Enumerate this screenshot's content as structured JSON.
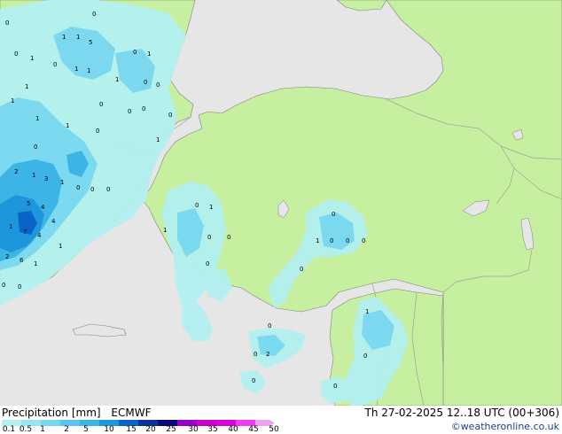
{
  "map": {
    "colors": {
      "sea": "#e6e6e6",
      "land": "#c6f0a0",
      "border": "#a0a0a0",
      "coast": "#808080"
    },
    "precip_values": [
      "0",
      "1",
      "1",
      "0",
      "5",
      "0",
      "1",
      "0",
      "1",
      "1",
      "1",
      "0",
      "1",
      "0",
      "0",
      "1",
      "0",
      "1",
      "1",
      "1",
      "0",
      "0",
      "0",
      "1",
      "0",
      "0",
      "2",
      "3",
      "1",
      "1",
      "5",
      "4",
      "0",
      "0",
      "0",
      "4",
      "1",
      "7",
      "4",
      "1",
      "2",
      "6",
      "1",
      "0",
      "0",
      "1",
      "0",
      "1",
      "0",
      "0",
      "0",
      "0",
      "0",
      "0",
      "0",
      "1",
      "0",
      "1",
      "0",
      "2",
      "0",
      "0",
      "0",
      "0"
    ]
  },
  "footer": {
    "title": "Precipitation [mm]",
    "model": "ECMWF",
    "valid_time": "Th 27-02-2025 12..18 UTC (00+306)",
    "credit": "©weatheronline.co.uk"
  },
  "legend": {
    "labels": [
      "0.1",
      "0.5",
      "1",
      "2",
      "5",
      "10",
      "15",
      "20",
      "25",
      "30",
      "35",
      "40",
      "45",
      "50"
    ],
    "colors": [
      "#b4f0f0",
      "#96e6f0",
      "#78d7f0",
      "#5ac3f0",
      "#3cb4e6",
      "#1e96dc",
      "#0a64c8",
      "#0a3296",
      "#0a0a78",
      "#9600c8",
      "#c800c8",
      "#dc00dc",
      "#f03cf0",
      "#f0a0f0"
    ]
  }
}
